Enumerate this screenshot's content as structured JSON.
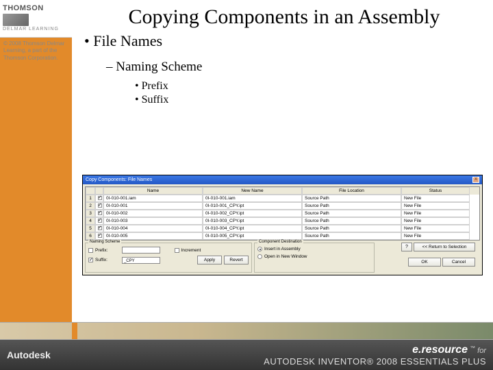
{
  "sidebar": {
    "brand": "THOMSON",
    "sub": "DELMAR LEARNING",
    "copyright": "© 2008 Thomson Delmar Learning, a part of the Thomson Corporation."
  },
  "title": "Copying Components in an Assembly",
  "bullets": {
    "l1": "File Names",
    "l2": "Naming Scheme",
    "l3a": "Prefix",
    "l3b": "Suffix"
  },
  "dialog": {
    "title": "Copy Components: File Names",
    "headers": {
      "name": "Name",
      "newname": "New Name",
      "loc": "File Location",
      "status": "Status"
    },
    "rows": [
      {
        "n": "1",
        "name": "0I-010-001.iam",
        "new": "0I-010-001.iam",
        "loc": "Source Path",
        "status": "New File"
      },
      {
        "n": "2",
        "name": "0I-010-001",
        "new": "0I-010-001_CPY.ipt",
        "loc": "Source Path",
        "status": "New File"
      },
      {
        "n": "3",
        "name": "0I-010-002",
        "new": "0I-010-002_CPY.ipt",
        "loc": "Source Path",
        "status": "New File"
      },
      {
        "n": "4",
        "name": "0I-010-003",
        "new": "0I-010-003_CPY.ipt",
        "loc": "Source Path",
        "status": "New File"
      },
      {
        "n": "5",
        "name": "0I-010-004",
        "new": "0I-010-004_CPY.ipt",
        "loc": "Source Path",
        "status": "New File"
      },
      {
        "n": "6",
        "name": "0I-010-005",
        "new": "0I-010-005_CPY.ipt",
        "loc": "Source Path",
        "status": "New File"
      }
    ],
    "naming": {
      "panel": "Naming Scheme",
      "prefix": "Prefix:",
      "suffix": "Suffix:",
      "suffix_value": "_CPY",
      "increment": "Increment",
      "apply": "Apply",
      "revert": "Revert"
    },
    "dest": {
      "panel": "Component Destination",
      "opt1": "Insert in Assembly",
      "opt2": "Open in New Window"
    },
    "buttons": {
      "return": "<< Return to Selection",
      "ok": "OK",
      "cancel": "Cancel"
    }
  },
  "footer": {
    "autodesk": "Autodesk",
    "eres": "e.resource",
    "for": "for",
    "product": "AUTODESK INVENTOR® 2008 ESSENTIALS PLUS"
  }
}
